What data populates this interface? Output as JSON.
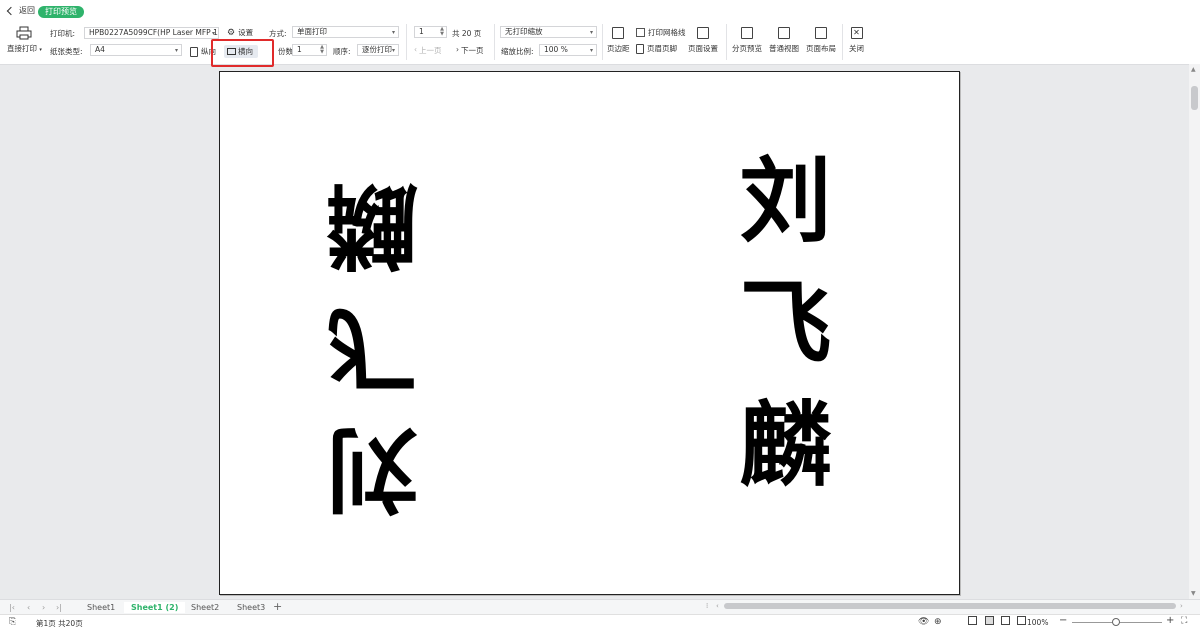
{
  "topbar": {
    "back_label": "返回",
    "mode_badge": "打印预览"
  },
  "ribbon": {
    "direct_print_label": "直接打印",
    "printer_label": "打印机:",
    "printer_value": "HPB0227A5099CF(HP Laser MFP 1:",
    "paper_type_label": "纸张类型:",
    "paper_type_value": "A4",
    "settings_label": "设置",
    "portrait_label": "纵向",
    "landscape_label": "横向",
    "method_label": "方式:",
    "method_value": "单面打印",
    "copies_label": "份数:",
    "copies_value": "1",
    "order_label": "顺序:",
    "order_value": "逐份打印",
    "page_input_value": "1",
    "total_pages_label": "共 20 页",
    "prev_page_label": "上一页",
    "next_page_label": "下一页",
    "scale_mode_value": "无打印缩放",
    "zoom_ratio_label": "缩放比例:",
    "zoom_ratio_value": "100 %",
    "print_gridlines_label": "打印网格线",
    "margins_label": "页边距",
    "header_footer_label": "页眉页脚",
    "page_setup_label": "页面设置",
    "page_break_preview_label": "分页预览",
    "normal_view_label": "普通视图",
    "page_layout_label": "页面布局",
    "close_label": "关闭"
  },
  "preview": {
    "left_column_text": "刘飞麟",
    "right_column_text": "刘飞麟"
  },
  "sheets": {
    "tabs": [
      "Sheet1",
      "Sheet1 (2)",
      "Sheet2",
      "Sheet3"
    ],
    "add_label": "+"
  },
  "status": {
    "page_info": "第1页 共20页",
    "zoom_value": "100%",
    "zoom_minus": "−",
    "zoom_plus": "+"
  },
  "colors": {
    "accent": "#2fb36b",
    "highlight_box": "#e02b2b"
  }
}
